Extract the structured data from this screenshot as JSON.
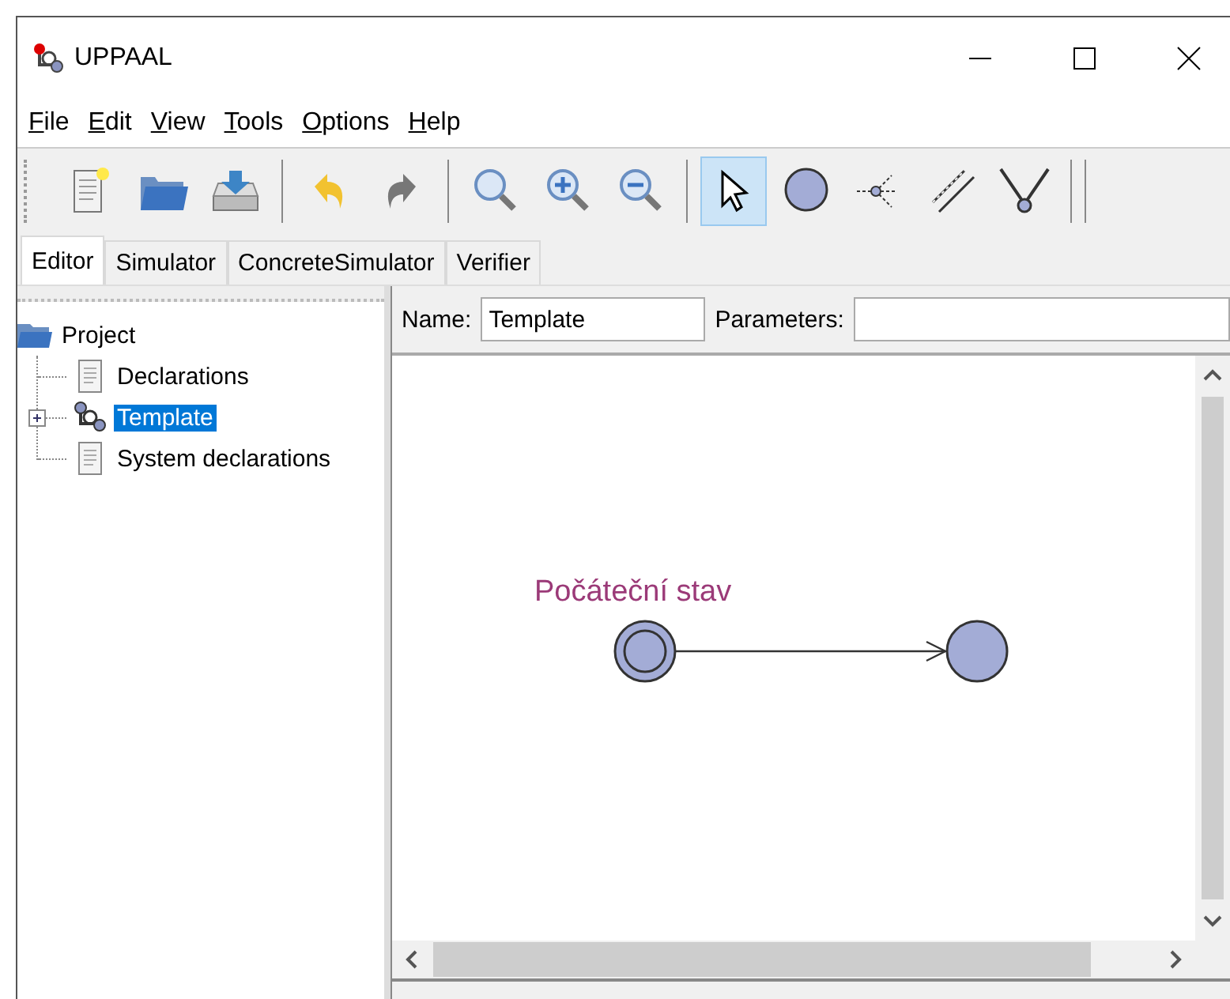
{
  "window": {
    "title": "UPPAAL"
  },
  "menu": [
    "File",
    "Edit",
    "View",
    "Tools",
    "Options",
    "Help"
  ],
  "toolbar": [
    {
      "kind": "new",
      "selected": false
    },
    {
      "kind": "open",
      "selected": false
    },
    {
      "kind": "save",
      "selected": false
    },
    {
      "kind": "sep"
    },
    {
      "kind": "undo",
      "selected": false
    },
    {
      "kind": "redo",
      "selected": false
    },
    {
      "kind": "sep"
    },
    {
      "kind": "zoom",
      "selected": false
    },
    {
      "kind": "zoomin",
      "selected": false
    },
    {
      "kind": "zoomout",
      "selected": false
    },
    {
      "kind": "sep"
    },
    {
      "kind": "select",
      "selected": true
    },
    {
      "kind": "location",
      "selected": false
    },
    {
      "kind": "branch",
      "selected": false
    },
    {
      "kind": "edge",
      "selected": false
    },
    {
      "kind": "nail",
      "selected": false
    }
  ],
  "tabs": [
    {
      "label": "Editor",
      "selected": true
    },
    {
      "label": "Simulator",
      "selected": false
    },
    {
      "label": "ConcreteSimulator",
      "selected": false
    },
    {
      "label": "Verifier",
      "selected": false
    }
  ],
  "tree": {
    "label": "Project",
    "children": [
      {
        "label": "Declarations",
        "kind": "doc",
        "selected": false
      },
      {
        "label": "Template",
        "kind": "template",
        "selected": true,
        "expanded": false
      },
      {
        "label": "System declarations",
        "kind": "doc",
        "selected": false
      }
    ]
  },
  "name_field": {
    "label": "Name:",
    "value": "Template"
  },
  "parameters_field": {
    "label": "Parameters:"
  },
  "canvas": {
    "locations": [
      {
        "kind": "initial",
        "label": "Počáteční stav"
      },
      {
        "kind": "normal"
      }
    ]
  }
}
